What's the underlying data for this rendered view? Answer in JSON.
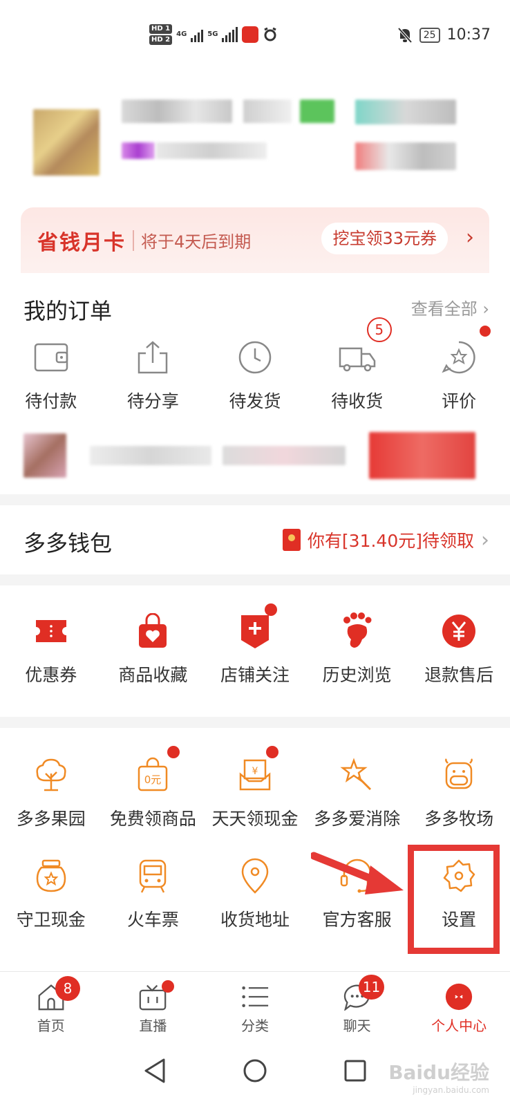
{
  "status_bar": {
    "sim1": "HD 1",
    "sim2": "HD 2",
    "net1": "4G",
    "net2": "5G",
    "battery": "25",
    "time": "10:37"
  },
  "vip_card": {
    "title": "省钱月卡",
    "subtitle": "将于4天后到期",
    "button": "挖宝领33元券"
  },
  "orders": {
    "title": "我的订单",
    "view_all": "查看全部",
    "items": [
      {
        "label": "待付款",
        "icon": "wallet-icon"
      },
      {
        "label": "待分享",
        "icon": "share-icon"
      },
      {
        "label": "待发货",
        "icon": "clock-icon"
      },
      {
        "label": "待收货",
        "icon": "truck-icon",
        "badge": "5"
      },
      {
        "label": "评价",
        "icon": "review-icon",
        "dot": true
      }
    ]
  },
  "wallet": {
    "title": "多多钱包",
    "promo": "你有[31.40元]待领取"
  },
  "quick": {
    "items": [
      {
        "label": "优惠券",
        "icon": "coupon-icon"
      },
      {
        "label": "商品收藏",
        "icon": "bag-heart-icon"
      },
      {
        "label": "店铺关注",
        "icon": "store-follow-icon",
        "dot": true
      },
      {
        "label": "历史浏览",
        "icon": "footprint-icon"
      },
      {
        "label": "退款售后",
        "icon": "refund-icon"
      }
    ]
  },
  "services": {
    "row1": [
      {
        "label": "多多果园",
        "icon": "tree-icon"
      },
      {
        "label": "免费领商品",
        "icon": "free-goods-icon",
        "dot": true
      },
      {
        "label": "天天领现金",
        "icon": "cash-icon",
        "dot": true
      },
      {
        "label": "多多爱消除",
        "icon": "star-wand-icon"
      },
      {
        "label": "多多牧场",
        "icon": "cow-icon"
      }
    ],
    "row2": [
      {
        "label": "守卫现金",
        "icon": "jar-icon"
      },
      {
        "label": "火车票",
        "icon": "train-icon"
      },
      {
        "label": "收货地址",
        "icon": "location-icon"
      },
      {
        "label": "官方客服",
        "icon": "headset-icon"
      },
      {
        "label": "设置",
        "icon": "gear-icon"
      }
    ]
  },
  "tabbar": {
    "items": [
      {
        "label": "首页",
        "icon": "home-icon",
        "badge": "8"
      },
      {
        "label": "直播",
        "icon": "tv-icon",
        "dot": true
      },
      {
        "label": "分类",
        "icon": "list-icon"
      },
      {
        "label": "聊天",
        "icon": "chat-icon",
        "badge": "11"
      },
      {
        "label": "个人中心",
        "icon": "profile-icon",
        "active": true
      }
    ]
  },
  "watermark": {
    "brand": "Baidu经验",
    "url": "jingyan.baidu.com"
  },
  "colors": {
    "accent": "#e02e24",
    "service_icon": "#f08a24"
  }
}
